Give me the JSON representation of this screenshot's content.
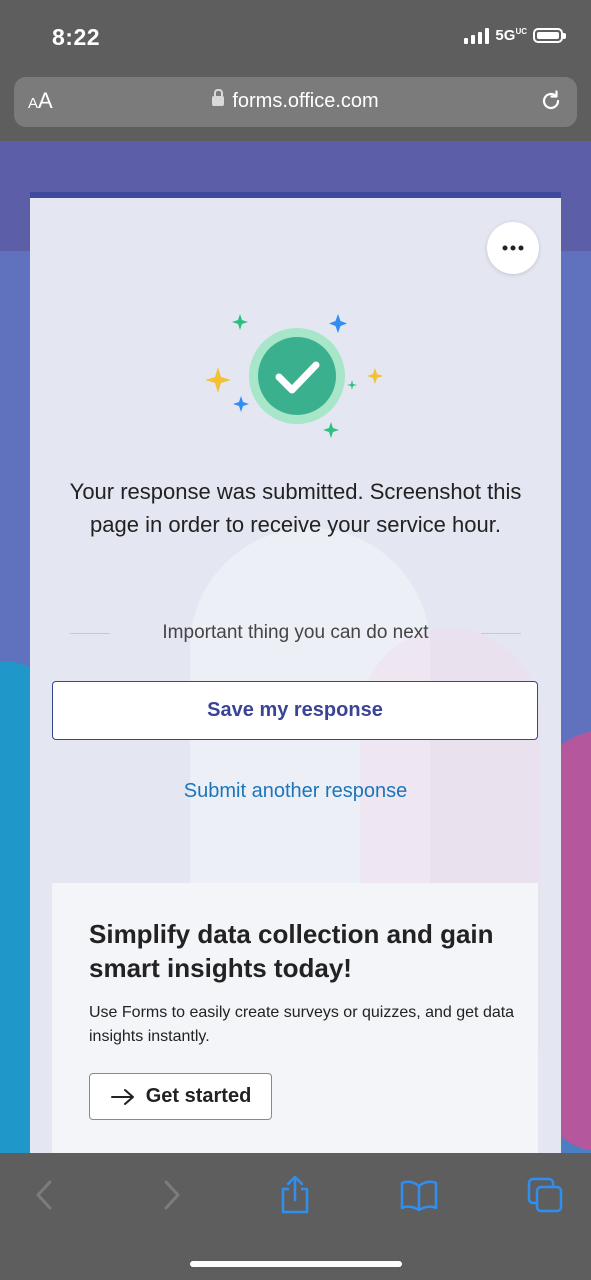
{
  "status_bar": {
    "time": "8:22",
    "network": "5G",
    "network_sup": "UC"
  },
  "browser": {
    "text_size_label_small": "A",
    "text_size_label_large": "A",
    "url": "forms.office.com"
  },
  "form": {
    "confirmation_message": "Your response was submitted. Screenshot this page in order to receive your service hour.",
    "next_steps_heading": "Important thing you can do next",
    "save_response_label": "Save my response",
    "submit_another_label": "Submit another response"
  },
  "promo": {
    "title": "Simplify data collection and gain smart insights today!",
    "description": "Use Forms to easily create surveys or quizzes, and get data insights instantly.",
    "cta_label": "Get started",
    "cta_icon": "arrow-right-icon"
  },
  "toolbar": {
    "icons": [
      "back-icon",
      "forward-icon",
      "share-icon",
      "bookmarks-icon",
      "tabs-icon"
    ]
  },
  "colors": {
    "accent": "#3a4497",
    "link": "#1c75bc",
    "success": "#3bb08f",
    "safari_blue": "#2f8ff0"
  }
}
